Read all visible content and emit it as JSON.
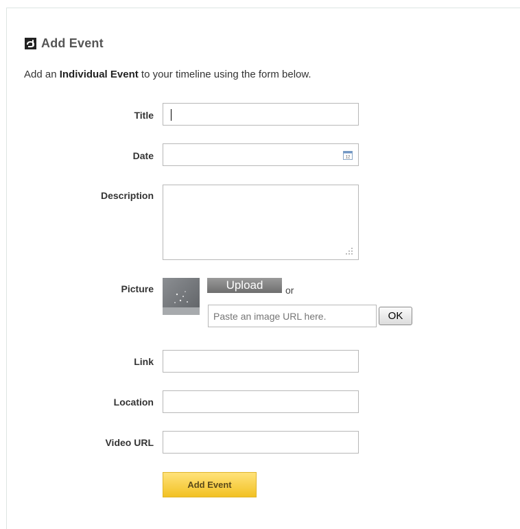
{
  "form": {
    "heading": "Add Event",
    "intro": {
      "prefix": "Add an ",
      "emphasis": "Individual Event",
      "suffix": " to your timeline using the form below."
    },
    "fields": {
      "title": {
        "label": "Title",
        "value": ""
      },
      "date": {
        "label": "Date",
        "value": "",
        "calendar_day": "12"
      },
      "description": {
        "label": "Description",
        "value": ""
      },
      "picture": {
        "label": "Picture",
        "upload_label": "Upload",
        "or_text": "or",
        "url_placeholder": "Paste an image URL here.",
        "ok_label": "OK"
      },
      "link": {
        "label": "Link",
        "value": ""
      },
      "location": {
        "label": "Location",
        "value": ""
      },
      "video_url": {
        "label": "Video URL",
        "value": ""
      }
    },
    "submit_label": "Add Event"
  },
  "colors": {
    "submit_bg": "#f2c123",
    "upload_bg": "#8a8a8a",
    "border": "#b7b7b7"
  }
}
